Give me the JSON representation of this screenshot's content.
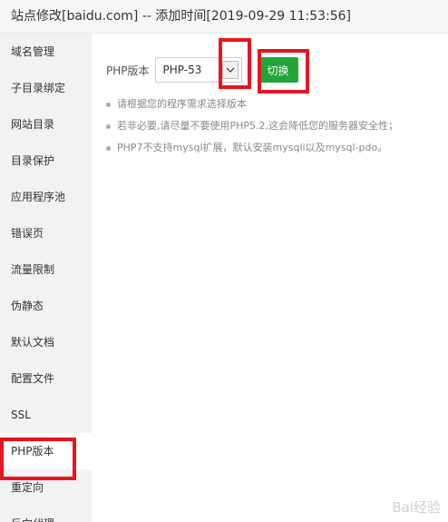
{
  "window": {
    "title": "站点修改[baidu.com] -- 添加时间[2019-09-29 11:53:56]"
  },
  "sidebar": {
    "items": [
      {
        "label": "域名管理"
      },
      {
        "label": "子目录绑定"
      },
      {
        "label": "网站目录"
      },
      {
        "label": "目录保护"
      },
      {
        "label": "应用程序池"
      },
      {
        "label": "错误页"
      },
      {
        "label": "流量限制"
      },
      {
        "label": "伪静态"
      },
      {
        "label": "默认文档"
      },
      {
        "label": "配置文件"
      },
      {
        "label": "SSL"
      },
      {
        "label": "PHP版本"
      },
      {
        "label": "重定向"
      },
      {
        "label": "反向代理"
      }
    ],
    "active_item": "PHP版本"
  },
  "php": {
    "label": "PHP版本",
    "selected_version": "PHP-53",
    "switch_button": "切换"
  },
  "notes": [
    "请根据您的程序需求选择版本",
    "若非必要,请尽量不要使用PHP5.2,这会降低您的服务器安全性；",
    "PHP7不支持mysql扩展，默认安装mysqli以及mysql-pdo。"
  ],
  "watermark": "Bai经验",
  "colors": {
    "accent_green": "#20a53a",
    "highlight_red": "#e8141f",
    "sidebar_bg": "#f2f2f2"
  }
}
